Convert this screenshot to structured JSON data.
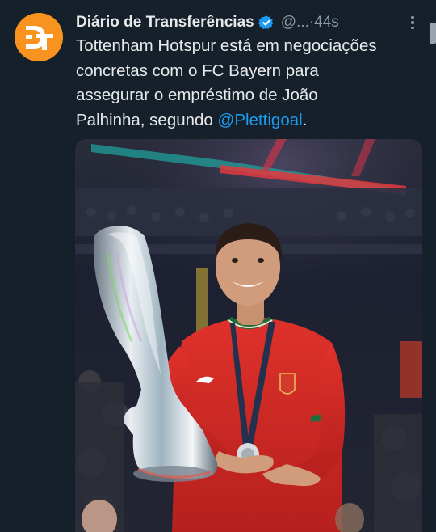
{
  "tweet": {
    "author_name": "Diário de Transferências",
    "handle": "@...",
    "separator": " · ",
    "time": "44s",
    "text_lines": [
      "Tottenham Hotspur está em negociações",
      "concretas com o FC Bayern para",
      "assegurar o empréstimo de João",
      "Palhinha, segundo "
    ],
    "mention": "@Plettigoal",
    "text_end": ".",
    "avatar_letters": "DT",
    "image_icon": "trophy-player-photo"
  },
  "colors": {
    "background": "#15202b",
    "text": "#e7e9ea",
    "secondary": "#8b98a5",
    "link": "#1d9bf0",
    "verified": "#1d9bf0",
    "avatar": "#f7931e"
  }
}
